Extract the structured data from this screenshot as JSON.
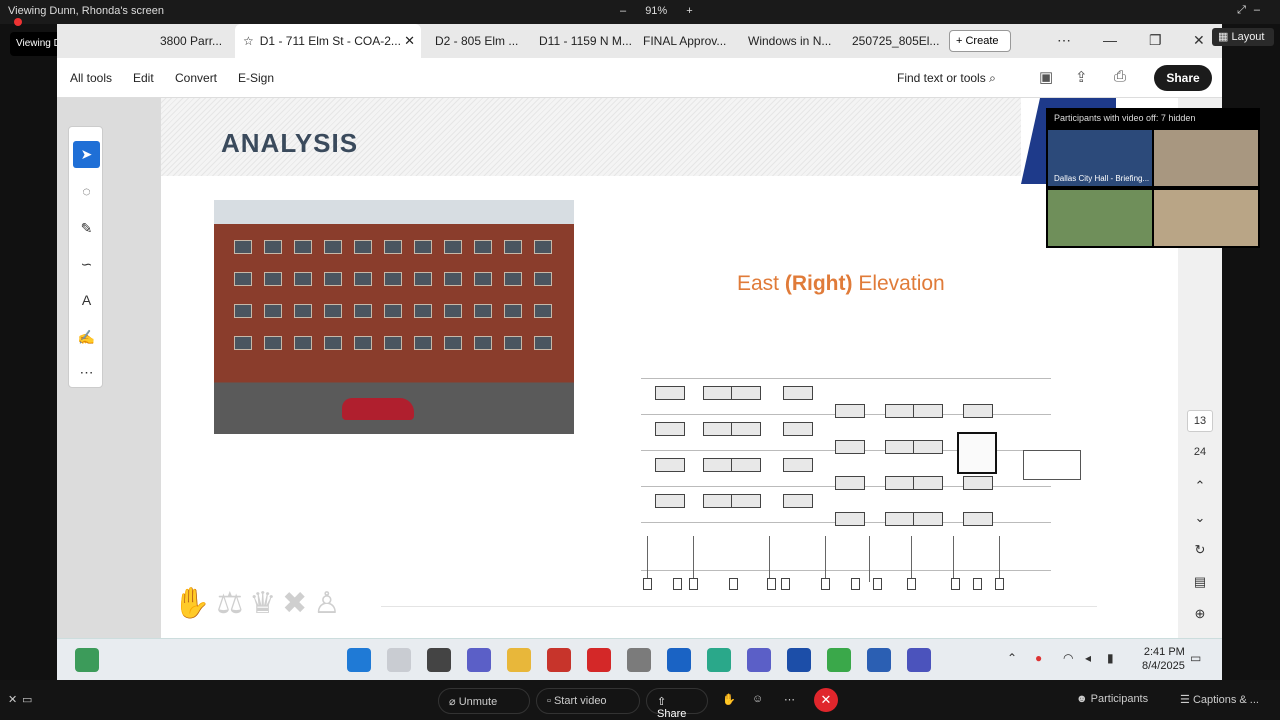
{
  "zoom_top": {
    "viewing_text": "Viewing Dunn, Rhonda's screen",
    "badge_text": "Viewing Dunn, Rhonda's screen",
    "zoom_minus": "–",
    "zoom_percent": "91%",
    "zoom_plus": "+",
    "layout_label": "Layout"
  },
  "tabs": [
    {
      "label": "3800 Parr..."
    },
    {
      "label": "D1 - 711 Elm St - COA-2..."
    },
    {
      "label": "D2 - 805 Elm ..."
    },
    {
      "label": "D11 - 1159 N M..."
    },
    {
      "label": "FINAL Approv..."
    },
    {
      "label": "Windows in N..."
    },
    {
      "label": "250725_805El..."
    }
  ],
  "create_label": "Create",
  "toolbar": {
    "menu": [
      "All tools",
      "Edit",
      "Convert",
      "E-Sign"
    ],
    "find_label": "Find text or tools",
    "share_label": "Share"
  },
  "page": {
    "title": "ANALYSIS",
    "elevation_prefix": "East ",
    "elevation_bold": "(Right)",
    "elevation_suffix": " Elevation"
  },
  "right_panel": {
    "current_page": "13",
    "total_pages": "24"
  },
  "videos": {
    "header": "Participants with video off: 7 hidden",
    "tile1_name": "Dallas City Hall - Briefing...",
    "colors": {
      "tile1": "#2c4a7a",
      "tile2": "#a89780",
      "tile3": "#6f8f5a",
      "tile4": "#b9a586"
    }
  },
  "taskbar": {
    "time": "2:41 PM",
    "date": "8/4/2025"
  },
  "zoom_bottom": {
    "unmute": "Unmute",
    "start_video": "Start video",
    "share": "Share",
    "participants": "Participants",
    "captions": "Captions & ..."
  },
  "colors": {
    "accent": "#1f6fd6",
    "elevation_title": "#e07b39",
    "end_call": "#e0262c"
  }
}
